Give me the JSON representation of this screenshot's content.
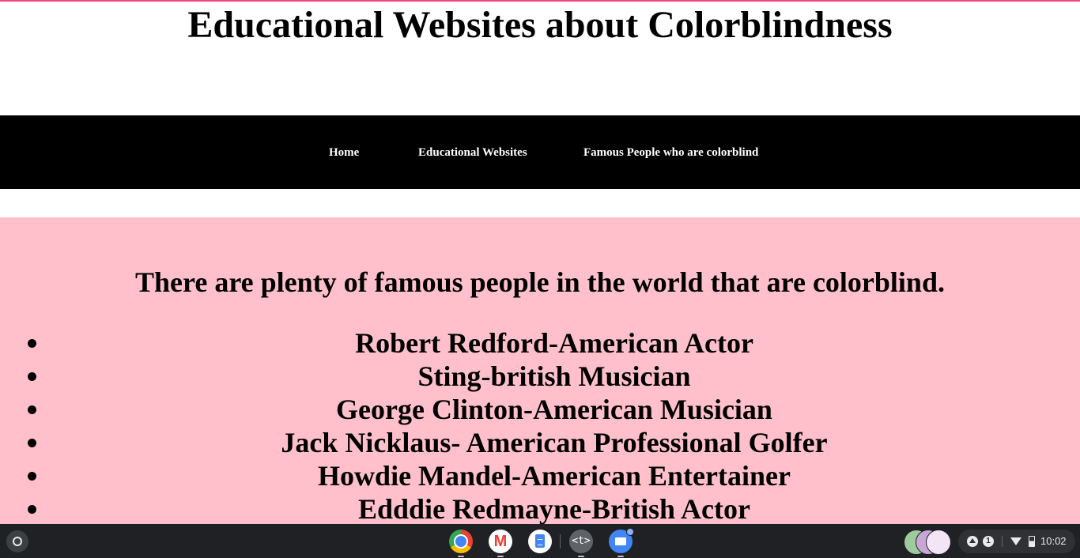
{
  "page": {
    "title": "Educational Websites about Colorblindness"
  },
  "nav": {
    "items": [
      {
        "label": "Home"
      },
      {
        "label": "Educational Websites"
      },
      {
        "label": "Famous People who are colorblind"
      }
    ]
  },
  "main": {
    "intro": "There are plenty of famous people in the world that are colorblind.",
    "people": [
      "Robert Redford-American Actor",
      "Sting-british Musician",
      "George Clinton-American Musician",
      "Jack Nicklaus- American Professional Golfer",
      "Howdie Mandel-American Entertainer",
      "Edddie Redmayne-British Actor"
    ]
  },
  "colors": {
    "accent": "#f0457a",
    "navbar": "#000000",
    "content_background": "#ffc0cb",
    "shelf": "#202124"
  },
  "shelf": {
    "apps": [
      {
        "icon": "chrome-icon"
      },
      {
        "icon": "gmail-icon",
        "glyph": "M"
      },
      {
        "icon": "docs-icon"
      },
      {
        "icon": "terminal-icon",
        "glyph": "<t>"
      },
      {
        "icon": "files-icon"
      }
    ],
    "launcher_icon": "launcher-icon",
    "tray": {
      "notification_count": "1",
      "time": "10:02",
      "battery_level": 0.55,
      "icons": [
        "upload-icon",
        "notification-badge",
        "wifi-icon",
        "battery-icon"
      ]
    }
  }
}
